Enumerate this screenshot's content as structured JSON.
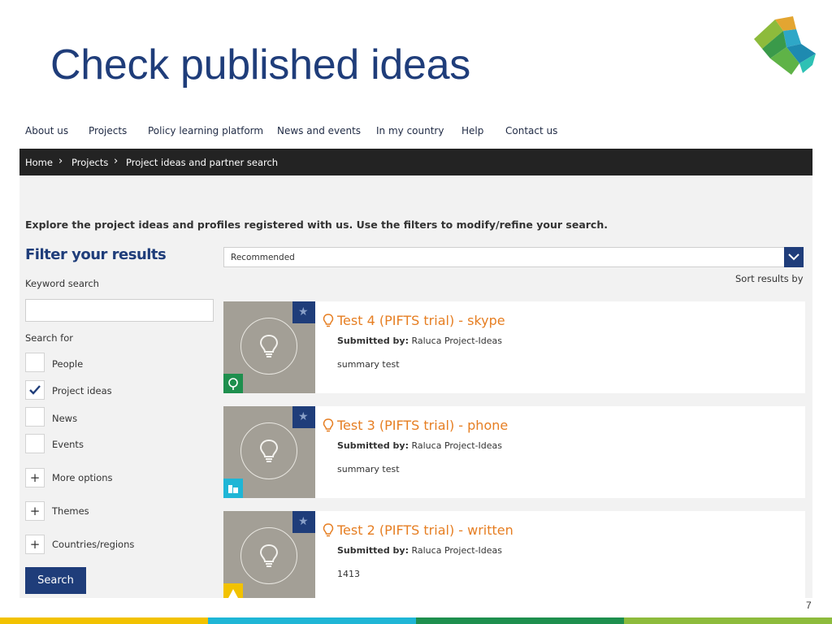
{
  "slide": {
    "title": "Check published ideas",
    "page_number": "7"
  },
  "nav": {
    "items": [
      "About us",
      "Projects",
      "Policy learning platform",
      "News and events",
      "In my country",
      "Help",
      "Contact us"
    ]
  },
  "breadcrumb": {
    "items": [
      "Home",
      "Projects",
      "Project ideas and partner search"
    ]
  },
  "intro": "Explore the project ideas and profiles registered with us. Use the filters to modify/refine your search.",
  "filters": {
    "title": "Filter your results",
    "keyword_label": "Keyword search",
    "keyword_value": "",
    "search_for_label": "Search for",
    "checkboxes": [
      {
        "label": "People",
        "checked": false
      },
      {
        "label": "Project ideas",
        "checked": true
      },
      {
        "label": "News",
        "checked": false
      },
      {
        "label": "Events",
        "checked": false
      }
    ],
    "expanders": [
      "More options",
      "Themes",
      "Countries/regions"
    ],
    "expander_symbol": "+",
    "search_button": "Search"
  },
  "sort": {
    "selected": "Recommended",
    "label": "Sort results by"
  },
  "results": [
    {
      "title": "Test 4 (PIFTS trial) - skype",
      "submitted_label": "Submitted by:",
      "submitted_by": "Raluca Project-Ideas",
      "summary": "summary test",
      "badge_color": "#1e8f4e"
    },
    {
      "title": "Test 3 (PIFTS trial) - phone",
      "submitted_label": "Submitted by:",
      "submitted_by": "Raluca Project-Ideas",
      "summary": "summary test",
      "badge_color": "#1fb6d6"
    },
    {
      "title": "Test 2 (PIFTS trial) - written",
      "submitted_label": "Submitted by:",
      "submitted_by": "Raluca Project-Ideas",
      "summary": "1413",
      "badge_color": "#f2c200"
    }
  ],
  "colors": {
    "brand_blue": "#1f3d7a",
    "accent_orange": "#e67e22",
    "breadcrumb_bg": "#232323"
  },
  "icons": {
    "logo": "interreg-europe-logo",
    "star": "star-icon",
    "bulb": "lightbulb-icon",
    "check": "checkmark-icon",
    "chevron": "chevron-down-icon"
  }
}
